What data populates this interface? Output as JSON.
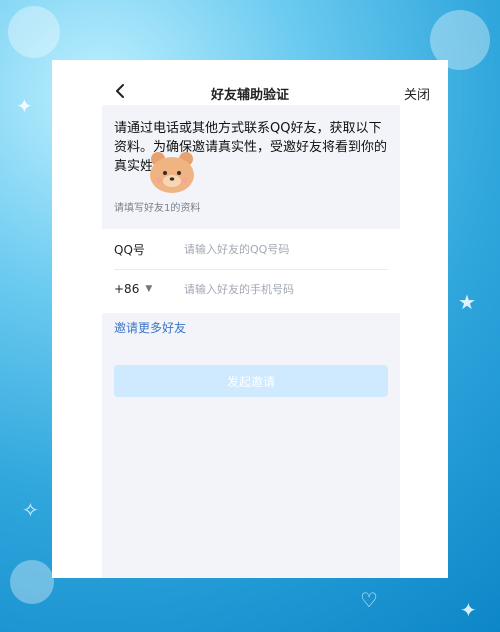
{
  "header": {
    "title": "好友辅助验证",
    "close_label": "关闭"
  },
  "info": {
    "text": "请通过电话或其他方式联系QQ好友，获取以下资料。为确保邀请真实性，受邀好友将看到你的真实姓名：",
    "hint": "请填写好友1的资料"
  },
  "form": {
    "qq_label": "QQ号",
    "qq_placeholder": "请输入好友的QQ号码",
    "country_code": "+86",
    "phone_placeholder": "请输入好友的手机号码"
  },
  "actions": {
    "invite_more": "邀请更多好友",
    "start_invite": "发起邀请"
  },
  "colors": {
    "accent": "#3d74c6",
    "button_disabled": "#cfe9ff"
  }
}
